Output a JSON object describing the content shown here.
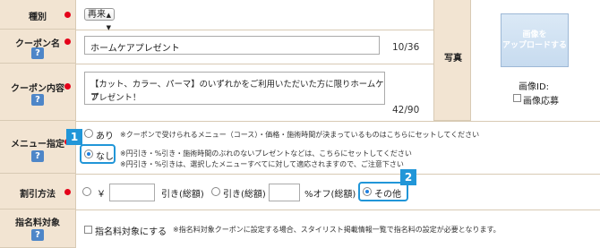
{
  "rows": {
    "category": {
      "label": "種別",
      "select_value": "再来"
    },
    "coupon_name": {
      "label": "クーポン名",
      "value": "ホームケアプレゼント",
      "count": "10/36"
    },
    "coupon_content": {
      "label": "クーポン内容",
      "value_line1": "【カット、カラー、パーマ】のいずれかをご利用いただいた方に限りホームケア",
      "value_line2": "プレゼント！",
      "count": "42/90"
    },
    "menu": {
      "label": "メニュー指定",
      "opt_ari": "あり",
      "opt_ari_note": "※クーポンで受けられるメニュー（コース）・価格・施術時間が決まっているものはこちらにセットしてください",
      "opt_nashi": "なし",
      "opt_nashi_note1": "※円引き・%引き・施術時間のぶれのないプレゼントなどは、こちらにセットしてください",
      "opt_nashi_note2": "※円引き・%引きは、選択したメニューすべてに対して適応されますので、ご注意下さい"
    },
    "discount": {
      "label": "割引方法",
      "yen": "￥",
      "opt_yen_off": "引き(総額)",
      "opt_pct_prefix": "引き(総額)",
      "pct_off": "%オフ(総額)",
      "opt_other": "その他"
    },
    "designation": {
      "label": "指名料対象",
      "checkbox_label": "指名料対象にする",
      "note": "※指名料対象クーポンに設定する場合、スタイリスト掲載情報一覧で指名料の設定が必要となります。"
    }
  },
  "photo": {
    "label": "写真",
    "upload_line1": "画像を",
    "upload_line2": "アップロードする",
    "image_id": "画像ID:",
    "image_apply": "画像応募"
  },
  "help_glyph": "?",
  "badges": {
    "b1": "1",
    "b2": "2"
  },
  "colors": {
    "accent": "#2196d8",
    "required": "#e4021a",
    "label_bg": "#f2e4d2"
  }
}
